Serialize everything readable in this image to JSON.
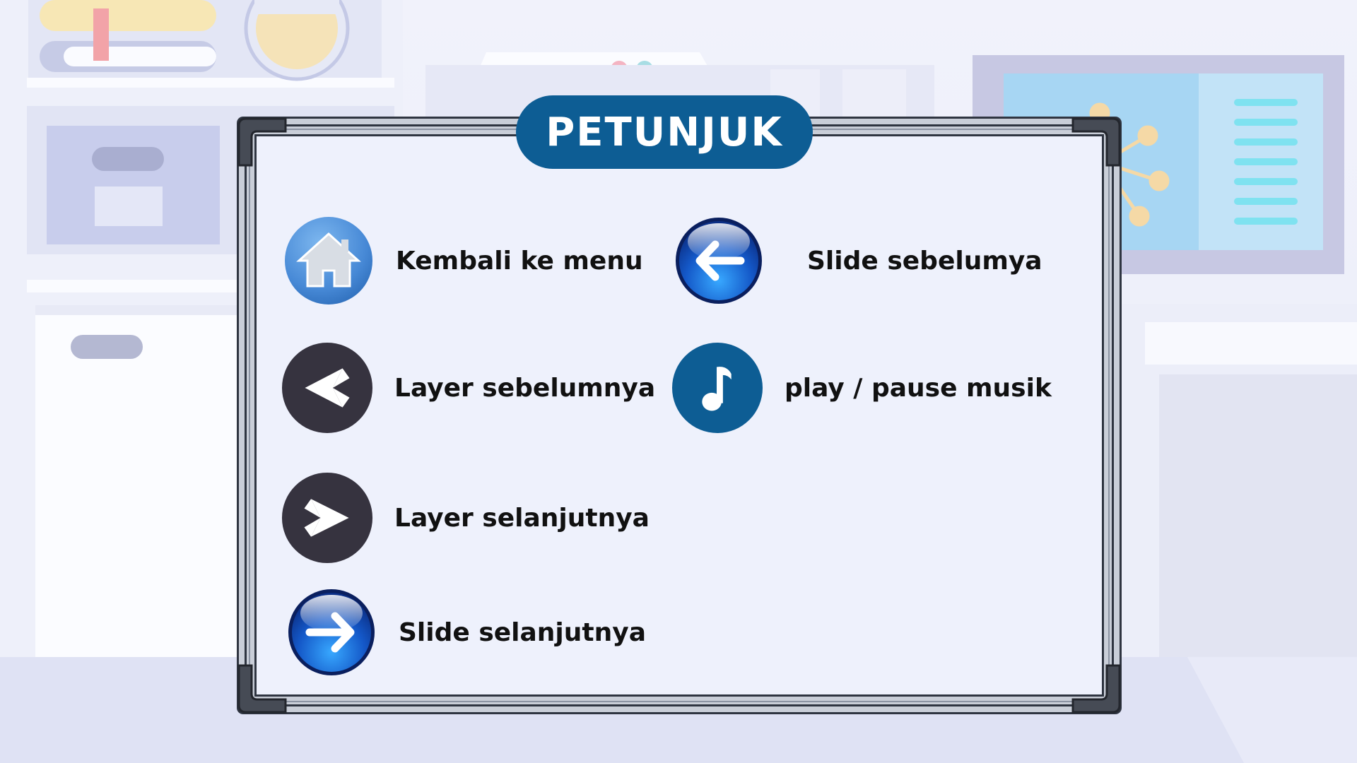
{
  "panel": {
    "title": "PETUNJUK"
  },
  "items": [
    {
      "icon": "home-icon",
      "label": "Kembali ke menu"
    },
    {
      "icon": "arrow-left-icon",
      "label": "Slide sebelumya"
    },
    {
      "icon": "chevron-left-icon",
      "label": "Layer sebelumnya"
    },
    {
      "icon": "music-note-icon",
      "label": "play / pause musik"
    },
    {
      "icon": "chevron-right-icon",
      "label": "Layer selanjutnya"
    },
    {
      "icon": "arrow-right-icon",
      "label": "Slide selanjutnya"
    }
  ],
  "colors": {
    "title_pill": "#0d5d94",
    "dark_button": "#36333f",
    "music_button": "#0d5d94",
    "home_button": "#4a8fd8",
    "glossy_button": "#1458c8"
  }
}
